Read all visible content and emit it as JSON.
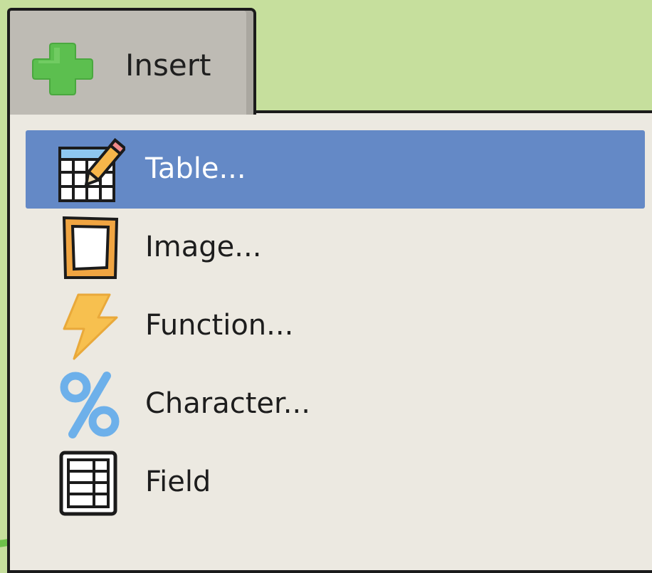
{
  "menu": {
    "title": "Insert",
    "title_icon": "plus-icon",
    "items": [
      {
        "label": "Table...",
        "icon": "table-icon",
        "selected": true
      },
      {
        "label": "Image...",
        "icon": "image-icon",
        "selected": false
      },
      {
        "label": "Function...",
        "icon": "lightning-icon",
        "selected": false
      },
      {
        "label": "Character...",
        "icon": "percent-icon",
        "selected": false
      },
      {
        "label": "Field",
        "icon": "field-icon",
        "selected": false
      }
    ]
  },
  "colors": {
    "background": "#c6df9d",
    "tab": "#bebbb4",
    "panel": "#ece9e1",
    "selected": "#6489c6",
    "plus": "#5cbf4f",
    "image_frame": "#f0a542",
    "lightning": "#f7c04f",
    "percent": "#6db0ea"
  }
}
